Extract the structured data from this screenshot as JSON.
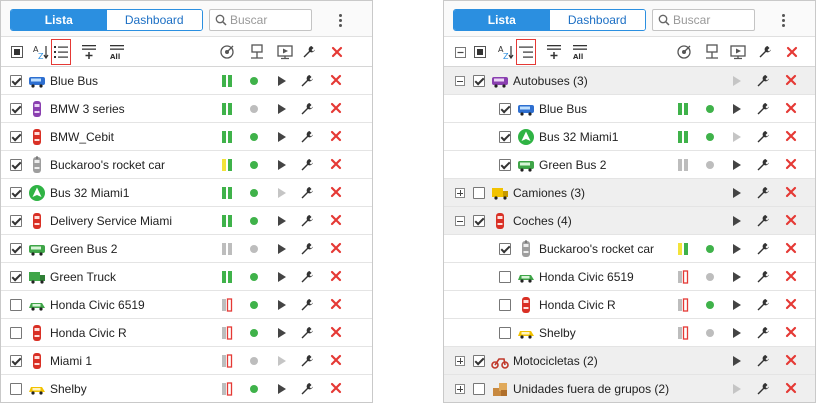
{
  "tabs": {
    "lista": "Lista",
    "dashboard": "Dashboard"
  },
  "search": {
    "placeholder": "Buscar"
  },
  "colors": {
    "accent": "#2b8fe0",
    "green": "#3fb24a",
    "yellow": "#f3e33a",
    "gray": "#bdbdbd",
    "red": "#e53935"
  },
  "left": {
    "rows": [
      {
        "label": "Blue Bus",
        "checked": true,
        "icon": "blue-bus-icon",
        "signal": "green",
        "dot": "green",
        "play": true
      },
      {
        "label": "BMW 3 series",
        "checked": true,
        "icon": "purple-car-icon",
        "signal": "green",
        "dot": "gray",
        "play": true
      },
      {
        "label": "BMW_Cebit",
        "checked": true,
        "icon": "red-car-icon",
        "signal": "green",
        "dot": "green",
        "play": true
      },
      {
        "label": "Buckaroo's rocket car",
        "checked": true,
        "icon": "rocket-car-icon",
        "signal": "yellow",
        "dot": "green",
        "play": true
      },
      {
        "label": "Bus 32 Miami1",
        "checked": true,
        "icon": "green-arrow-icon",
        "signal": "green",
        "dot": "green",
        "play": false
      },
      {
        "label": "Delivery Service Miami",
        "checked": true,
        "icon": "red-car-icon",
        "signal": "green",
        "dot": "green",
        "play": true
      },
      {
        "label": "Green Bus 2",
        "checked": true,
        "icon": "green-bus-icon",
        "signal": "gray",
        "dot": "gray",
        "play": true
      },
      {
        "label": "Green Truck",
        "checked": true,
        "icon": "green-truck-icon",
        "signal": "green",
        "dot": "green",
        "play": true
      },
      {
        "label": "Honda Civic 6519",
        "checked": false,
        "icon": "green-car-icon",
        "signal": "red",
        "dot": "green",
        "play": true
      },
      {
        "label": "Honda Civic R",
        "checked": false,
        "icon": "red-car-icon",
        "signal": "red",
        "dot": "green",
        "play": true
      },
      {
        "label": "Miami 1",
        "checked": true,
        "icon": "red-car-icon",
        "signal": "red",
        "dot": "gray",
        "play": false
      },
      {
        "label": "Shelby",
        "checked": false,
        "icon": "yellow-car-icon",
        "signal": "red",
        "dot": "green",
        "play": true
      }
    ]
  },
  "right": {
    "rows": [
      {
        "type": "group",
        "label": "Autobuses (3)",
        "expanded": true,
        "checked": true,
        "icon": "purple-bus-icon",
        "play": false
      },
      {
        "type": "unit",
        "label": "Blue Bus",
        "checked": true,
        "icon": "blue-bus-icon",
        "signal": "green",
        "dot": "green",
        "play": true
      },
      {
        "type": "unit",
        "label": "Bus 32 Miami1",
        "checked": true,
        "icon": "green-arrow-icon",
        "signal": "green",
        "dot": "green",
        "play": false
      },
      {
        "type": "unit",
        "label": "Green Bus 2",
        "checked": true,
        "icon": "green-bus-icon",
        "signal": "gray",
        "dot": "gray",
        "play": true
      },
      {
        "type": "group",
        "label": "Camiones (3)",
        "expanded": false,
        "checked": false,
        "icon": "yellow-truck-icon",
        "play": true
      },
      {
        "type": "group",
        "label": "Coches (4)",
        "expanded": true,
        "checked": true,
        "icon": "red-car-icon",
        "play": true
      },
      {
        "type": "unit",
        "label": "Buckaroo's rocket car",
        "checked": true,
        "icon": "rocket-car-icon",
        "signal": "yellow",
        "dot": "green",
        "play": true
      },
      {
        "type": "unit",
        "label": "Honda Civic 6519",
        "checked": false,
        "icon": "green-car-icon",
        "signal": "red",
        "dot": "gray",
        "play": true
      },
      {
        "type": "unit",
        "label": "Honda Civic R",
        "checked": false,
        "icon": "red-car-icon",
        "signal": "red",
        "dot": "green",
        "play": true
      },
      {
        "type": "unit",
        "label": "Shelby",
        "checked": false,
        "icon": "yellow-car-icon",
        "signal": "red",
        "dot": "gray",
        "play": true
      },
      {
        "type": "group",
        "label": "Motocicletas (2)",
        "expanded": false,
        "checked": true,
        "icon": "motorcycle-icon",
        "play": true
      },
      {
        "type": "group",
        "label": "Unidades fuera de grupos (2)",
        "expanded": false,
        "checked": false,
        "icon": "boxes-icon",
        "play": false
      }
    ]
  }
}
